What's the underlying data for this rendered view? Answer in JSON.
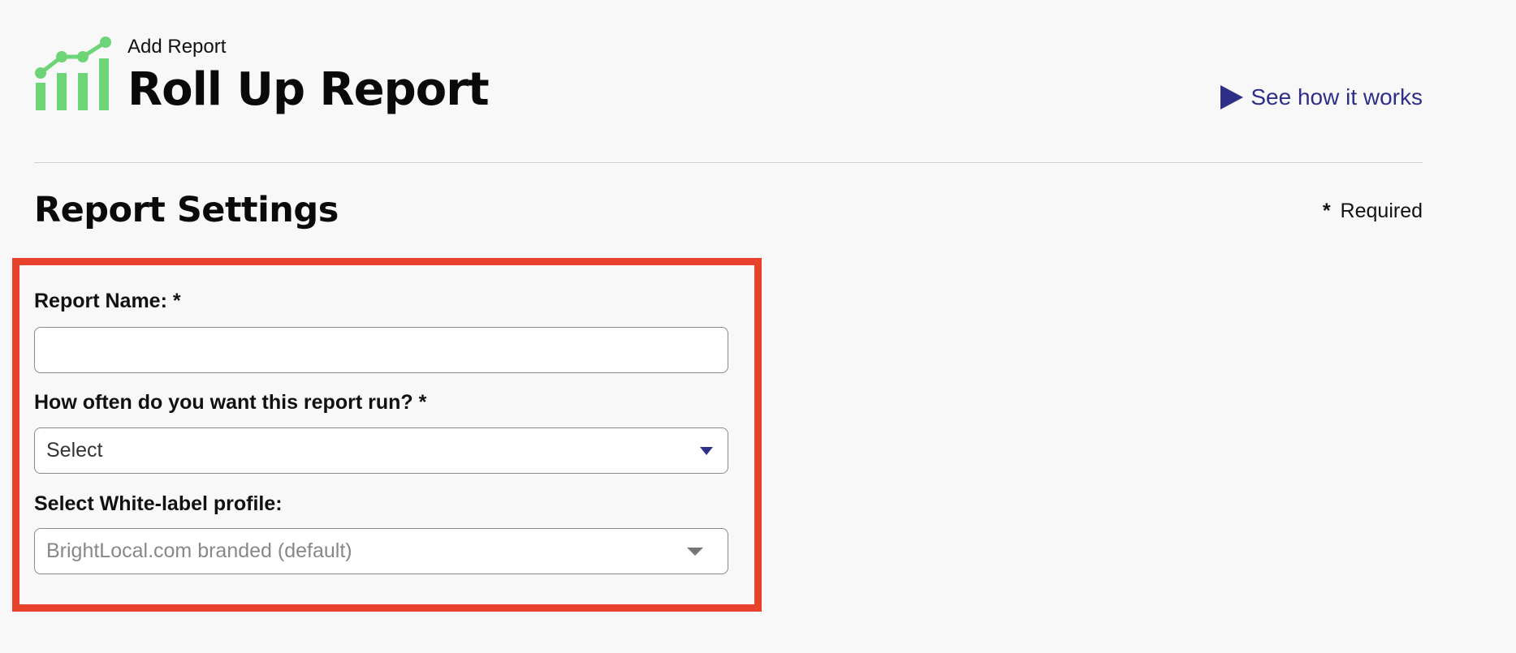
{
  "header": {
    "breadcrumb": "Add Report",
    "title": "Roll Up Report",
    "how_link": "See how it works"
  },
  "section": {
    "title": "Report Settings",
    "required_star": "*",
    "required_label": "Required"
  },
  "form": {
    "report_name": {
      "label": "Report Name: *",
      "value": "",
      "placeholder": ""
    },
    "frequency": {
      "label": "How often do you want this report run? *",
      "selected": "Select"
    },
    "white_label": {
      "label": "Select White-label profile:",
      "selected": "BrightLocal.com branded (default)"
    }
  },
  "colors": {
    "logo_green": "#6dd477",
    "link_blue": "#2e2f86",
    "highlight_red": "#e8412c",
    "background": "#f8f8f8"
  },
  "icons": {
    "logo": "bar-chart-trend-icon",
    "how_link": "play-icon",
    "frequency_caret": "caret-down-icon",
    "white_label_caret": "caret-down-icon"
  }
}
